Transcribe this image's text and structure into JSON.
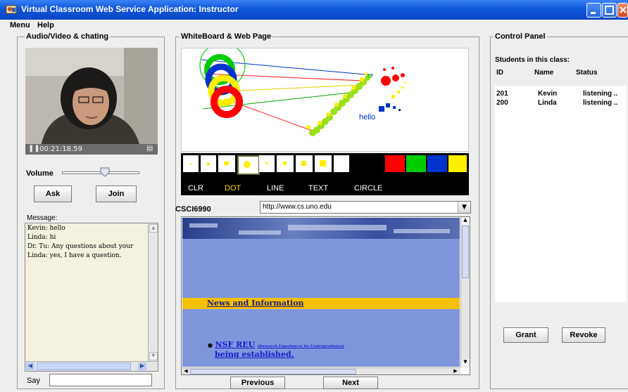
{
  "window": {
    "title": "Virtual Classroom Web Service Application: Instructor"
  },
  "menu": {
    "items": [
      "Menu",
      "Help"
    ]
  },
  "av_panel": {
    "title": "Audio/Video & chating",
    "video_time": "00:21:18.59",
    "volume_label": "Volume",
    "volume_level": 0.55,
    "ask_label": "Ask",
    "join_label": "Join",
    "message_label": "Message:",
    "messages": [
      "Kevin: hello",
      "Linda: hi",
      "Dr. Tu: Any questions about your",
      "Linda: yes, I have a question."
    ],
    "say_label": "Say",
    "say_value": ""
  },
  "whiteboard": {
    "title": "WhiteBoard & Web Page",
    "canvas_text": "hello",
    "tools": [
      "CLR",
      "DOT",
      "LINE",
      "TEXT",
      "CIRCLE"
    ],
    "active_tool": "DOT",
    "active_tool_color": "#ffd800",
    "colors": [
      "#ff0000",
      "#00cc00",
      "#0033cc",
      "#ffee00"
    ],
    "course_label": "CSCI6990",
    "url_value": "http://www.cs.uno.edu",
    "web_news": "News and Information",
    "web_link_main": "NSF REU",
    "web_link_small": "(Research Experiences for Undergraduates)",
    "web_link_line2": "being established.",
    "previous_label": "Previous",
    "next_label": "Next"
  },
  "control_panel": {
    "title": "Control Panel",
    "students_label": "Students in this class:",
    "columns": [
      "ID",
      "Name",
      "Status"
    ],
    "rows": [
      {
        "id": "201",
        "name": "Kevin",
        "status": "listening .."
      },
      {
        "id": "200",
        "name": "Linda",
        "status": "listening .."
      }
    ],
    "grant_label": "Grant",
    "revoke_label": "Revoke"
  }
}
